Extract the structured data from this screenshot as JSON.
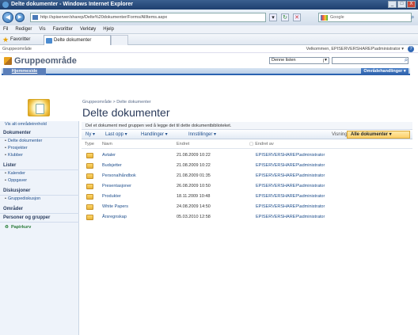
{
  "window": {
    "title": "Delte dokumenter - Windows Internet Explorer",
    "controls": [
      "_",
      "□",
      "X"
    ]
  },
  "address_bar": {
    "url": "http://spiserver/sharep/Delte%20dokumenter/Forms/AllItems.aspx",
    "search_placeholder": "Google",
    "refresh": "↻",
    "stop": "✕"
  },
  "menu": [
    "Fil",
    "Rediger",
    "Vis",
    "Favoritter",
    "Verktøy",
    "Hjelp"
  ],
  "favorites": {
    "label": "Favoritter",
    "tab": "Delte dokumenter"
  },
  "header": {
    "breadcrumb": "Gruppeområde",
    "welcome": "Velkommen, EPISERVERSHAREP\\administrator ▾",
    "help": "?"
  },
  "site": {
    "title": "Gruppeområde",
    "search_scope": "Denne listen",
    "search_go": "⌕"
  },
  "topnav": {
    "home": "Hjemmeside",
    "site_actions": "Områdehandlinger ▾"
  },
  "page": {
    "breadcrumb": "Gruppeområde > Delte dokumenter",
    "title": "Delte dokumenter",
    "description": "Del et dokument med gruppen ved å legge det til dette dokumentbiblioteket."
  },
  "leftnav": {
    "view_all": "Vis alt områdeinnhold",
    "documents_head": "Dokumenter",
    "documents": [
      "Delte dokumenter",
      "Prosjekter",
      "Klubber"
    ],
    "lists_head": "Lister",
    "lists": [
      "Kalender",
      "Oppgaver"
    ],
    "discussions_head": "Diskusjoner",
    "discussions": [
      "Gruppediskusjon"
    ],
    "sites_head": "Områder",
    "people_head": "Personer og grupper",
    "recycle": "Papirkurv"
  },
  "toolbar": {
    "new": "Ny ▾",
    "upload": "Last opp ▾",
    "actions": "Handlinger ▾",
    "settings": "Innstillinger ▾",
    "view_label": "Visning:",
    "view_value": "Alle dokumenter ▾"
  },
  "table": {
    "headers": [
      "Type",
      "Navn",
      "Endret",
      "Endret av"
    ],
    "rows": [
      {
        "name": "Avtaler",
        "modified": "21.08.2009 10:22",
        "by": "EPISERVERSHAREP\\administrator"
      },
      {
        "name": "Budsjetter",
        "modified": "21.08.2009 10:22",
        "by": "EPISERVERSHAREP\\administrator"
      },
      {
        "name": "Personalhåndbok",
        "modified": "21.08.2009 01:35",
        "by": "EPISERVERSHAREP\\administrator"
      },
      {
        "name": "Presentasjoner",
        "modified": "26.08.2009 10:50",
        "by": "EPISERVERSHAREP\\administrator"
      },
      {
        "name": "Produkter",
        "modified": "18.11.2009 10:48",
        "by": "EPISERVERSHAREP\\administrator"
      },
      {
        "name": "White Papers",
        "modified": "24.08.2009 14:50",
        "by": "EPISERVERSHAREP\\administrator"
      },
      {
        "name": "Årsregnskap",
        "modified": "05.03.2010 12:58",
        "by": "EPISERVERSHAREP\\administrator"
      }
    ]
  },
  "colors": {
    "title_bar": "#1d3f6f",
    "topnav_accent": "#2a62b0",
    "view_selector": "#fcd06a"
  }
}
